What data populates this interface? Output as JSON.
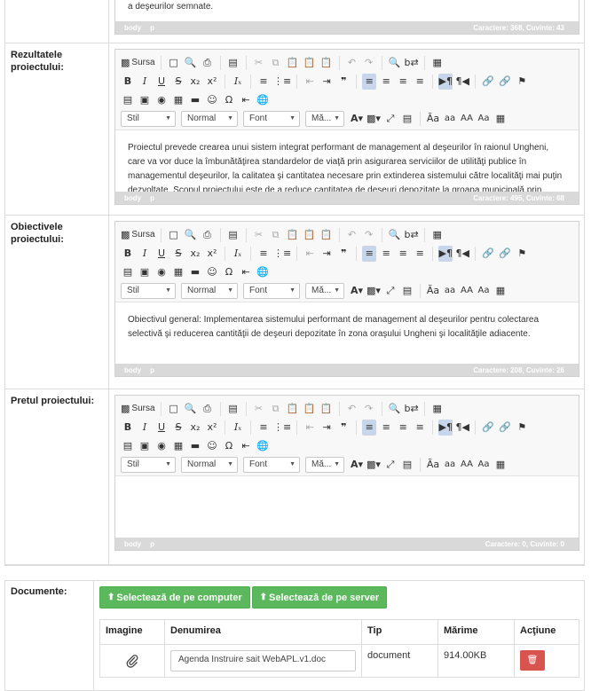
{
  "toolbar": {
    "source_label": "Sursa",
    "style_combo": "Stil",
    "format_combo": "Normal",
    "font_combo": "Font",
    "size_combo": "Mă...",
    "aa1": "aa",
    "aa2": "AA",
    "aa3": "Aa"
  },
  "top_section": {
    "text": "a deşeurilor semnate.",
    "path": [
      "body",
      "p"
    ],
    "count": "Caractere: 368, Cuvinte: 43"
  },
  "sections": [
    {
      "label": "Rezultatele proiectului:",
      "content": "Proiectul prevede crearea unui sistem integrat performant de management al deşeurilor în raionul Ungheni, care va vor duce la îmbunătăţirea standardelor de viaţă prin asigurarea serviciilor de utilităţi publice în managementul deşeurilor, la calitatea şi cantitatea necesare prin extinderea sistemului către localităţi mai puţin dezvoltate. Scopul proiectului este de a reduce cantitatea de deşeuri depozitate la groapa municipală prin colectarea selectivă şi reciclarea utilităţilor existente...",
      "path": [
        "body",
        "p"
      ],
      "count": "Caractere: 495, Cuvinte: 68"
    },
    {
      "label": "Obiectivele proiectului:",
      "content": "Obiectivul general: Implementarea sistemului performant de management al deşeurilor pentru colectarea selectivă şi reducerea cantităţii de deşeuri depozitate în zona oraşului Ungheni şi localităţile adiacente.",
      "path": [
        "body",
        "p"
      ],
      "count": "Caractere: 208, Cuvinte: 26"
    },
    {
      "label": "Pretul proiectului:",
      "content": "",
      "path": [
        "body",
        "p"
      ],
      "count": "Caractere: 0, Cuvinte: 0"
    }
  ],
  "documents": {
    "label": "Documente:",
    "btn_computer": "Selectează de pe computer",
    "btn_server": "Selectează de pe server",
    "columns": [
      "Imagine",
      "Denumirea",
      "Tip",
      "Mărime",
      "Acţiune"
    ],
    "rows": [
      {
        "name": "Agenda Instruire sait WebAPL.v1.doc",
        "type": "document",
        "size": "914.00KB"
      }
    ]
  }
}
